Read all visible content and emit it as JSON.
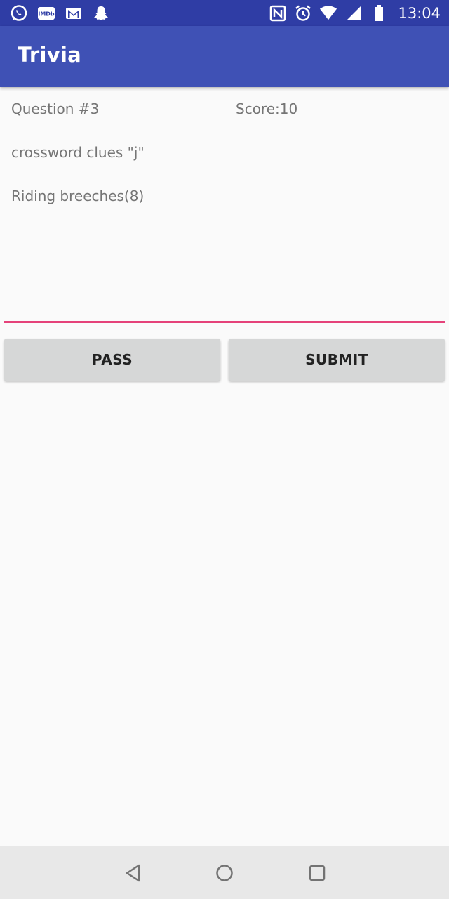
{
  "status_bar": {
    "time": "13:04",
    "left_icons": [
      "whatsapp-icon",
      "imdb-icon",
      "gmail-icon",
      "snapchat-icon"
    ],
    "right_icons": [
      "nfc-icon",
      "alarm-icon",
      "wifi-icon",
      "signal-icon",
      "battery-icon"
    ],
    "imdb_text": "IMDb"
  },
  "app_bar": {
    "title": "Trivia",
    "color": "#3f51b5"
  },
  "question": {
    "number_label": "Question #3",
    "score_label": "Score:10",
    "category": "crossword clues \"j\"",
    "clue": "Riding breeches(8)"
  },
  "answer": {
    "value": "",
    "placeholder": "",
    "underline_color": "#e5427a"
  },
  "buttons": {
    "pass_label": "PASS",
    "submit_label": "SUBMIT"
  },
  "nav_bar": {
    "icons": [
      "back-icon",
      "home-icon",
      "recents-icon"
    ]
  }
}
